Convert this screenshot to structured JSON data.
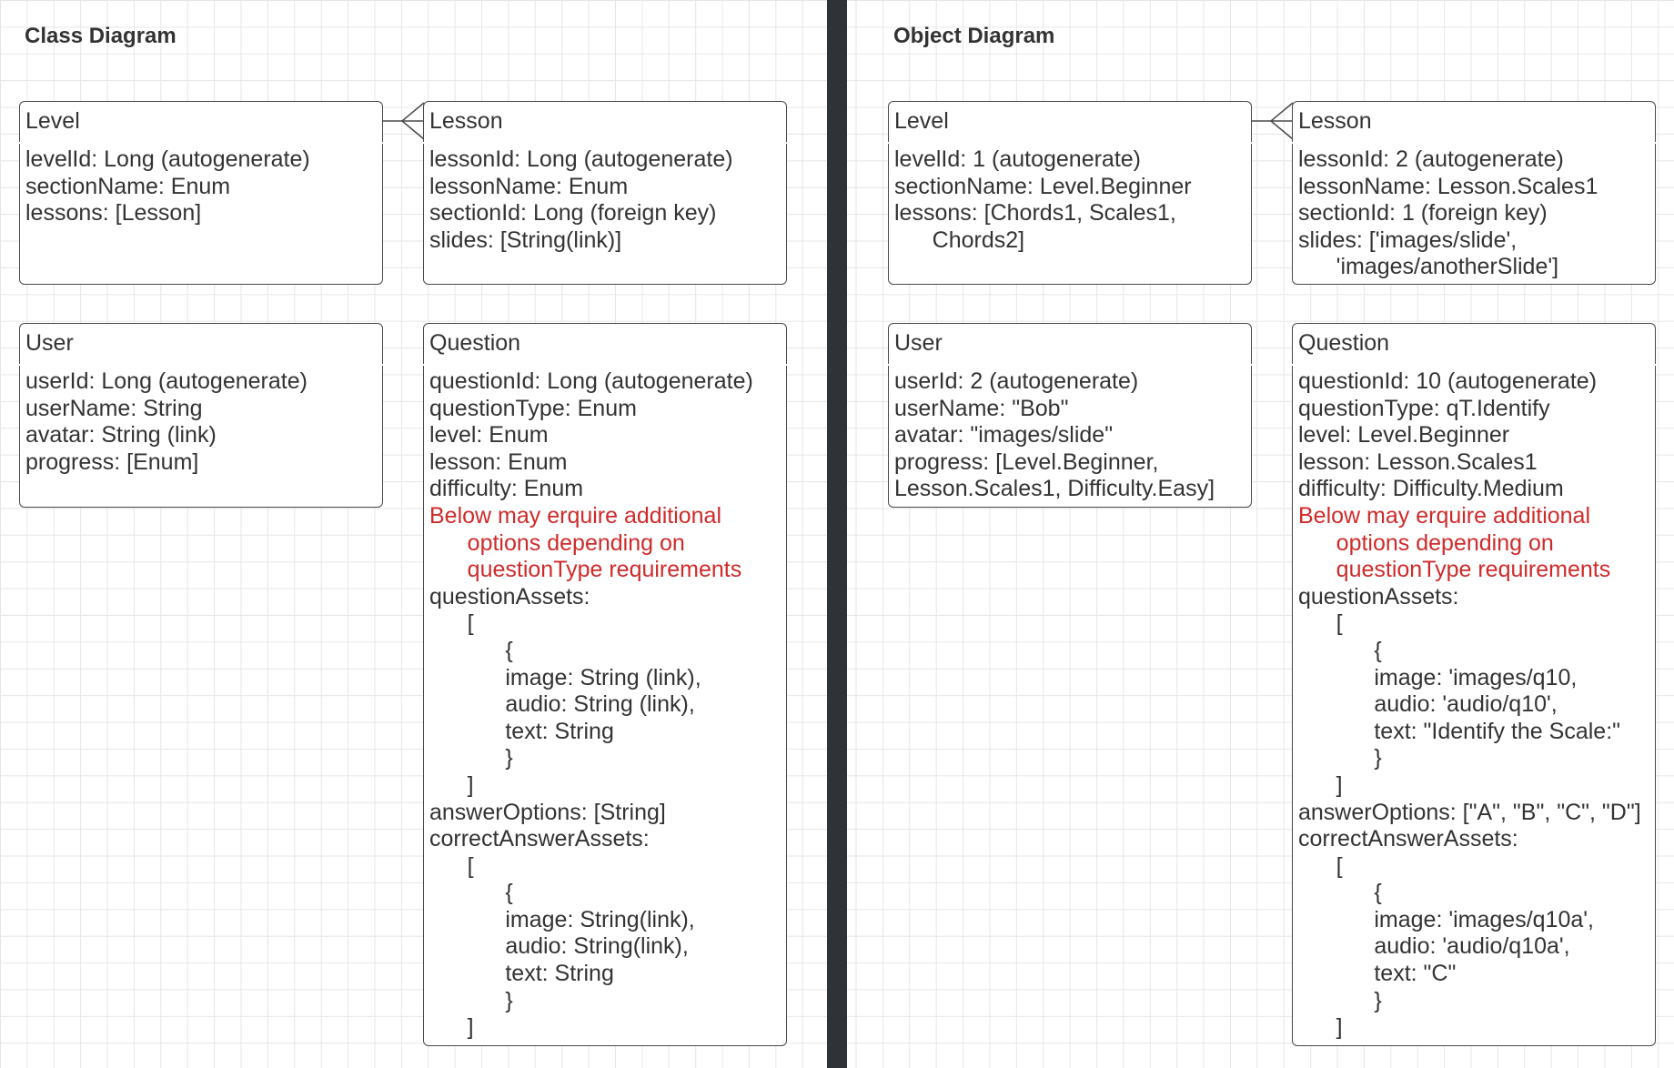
{
  "colors": {
    "accent_warning": "#cf2a2a",
    "divider": "#2f3338",
    "stroke": "#4a4a4a"
  },
  "class_diagram": {
    "title": "Class Diagram",
    "level": {
      "name": "Level",
      "attributes": [
        "levelId: Long (autogenerate)",
        "sectionName: Enum",
        "lessons: [Lesson]"
      ]
    },
    "lesson": {
      "name": "Lesson",
      "attributes": [
        "lessonId: Long (autogenerate)",
        "lessonName: Enum",
        "sectionId: Long (foreign key)",
        "slides: [String(link)]"
      ]
    },
    "user": {
      "name": "User",
      "attributes": [
        "userId: Long (autogenerate)",
        "userName: String",
        "avatar: String (link)",
        "progress: [Enum]"
      ]
    },
    "question": {
      "name": "Question",
      "attributes": [
        "questionId: Long (autogenerate)",
        "questionType: Enum",
        "level: Enum",
        "lesson: Enum",
        "difficulty: Enum",
        "Below may erquire additional",
        "      options depending on",
        "      questionType requirements",
        "questionAssets:",
        "      [",
        "            {",
        "            image: String (link),",
        "            audio: String (link),",
        "            text: String",
        "            }",
        "      ]",
        "answerOptions: [String]",
        "correctAnswerAssets:",
        "      [",
        "            {",
        "            image: String(link),",
        "            audio: String(link),",
        "            text: String",
        "            }",
        "      ]"
      ]
    }
  },
  "object_diagram": {
    "title": "Object Diagram",
    "level": {
      "name": "Level",
      "attributes": [
        "levelId: 1 (autogenerate)",
        "sectionName: Level.Beginner",
        "lessons: [Chords1, Scales1,",
        "      Chords2]"
      ]
    },
    "lesson": {
      "name": "Lesson",
      "attributes": [
        "lessonId: 2 (autogenerate)",
        "lessonName: Lesson.Scales1",
        "sectionId: 1 (foreign key)",
        "slides: ['images/slide',",
        "      'images/anotherSlide']"
      ]
    },
    "user": {
      "name": "User",
      "attributes": [
        "userId: 2 (autogenerate)",
        "userName: \"Bob\"",
        "avatar: \"images/slide\"",
        "progress: [Level.Beginner,",
        "Lesson.Scales1, Difficulty.Easy]"
      ]
    },
    "question": {
      "name": "Question",
      "attributes": [
        "questionId: 10 (autogenerate)",
        "questionType: qT.Identify",
        "level: Level.Beginner",
        "lesson: Lesson.Scales1",
        "difficulty: Difficulty.Medium",
        "Below may erquire additional",
        "      options depending on",
        "      questionType requirements",
        "questionAssets:",
        "      [",
        "            {",
        "            image: 'images/q10,",
        "            audio: 'audio/q10',",
        "            text: \"Identify the Scale:\"",
        "            }",
        "      ]",
        "answerOptions: [\"A\", \"B\", \"C\", \"D\"]",
        "correctAnswerAssets:",
        "      [",
        "            {",
        "            image: 'images/q10a',",
        "            audio: 'audio/q10a',",
        "            text: \"C\"",
        "            }",
        "      ]"
      ]
    }
  }
}
